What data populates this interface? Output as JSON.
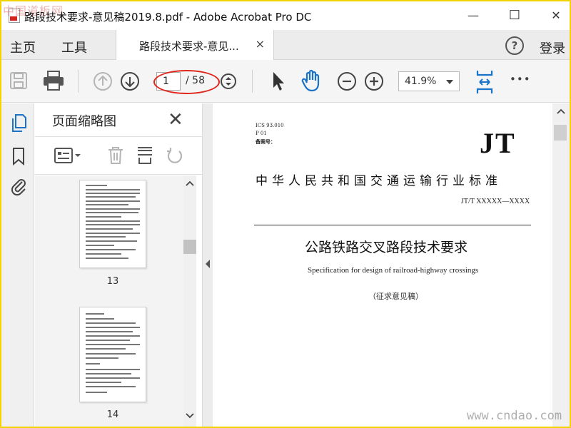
{
  "window": {
    "title": "路段技术要求-意见稿2019.8.pdf - Adobe Acrobat Pro DC",
    "watermark_top": "中国道板网",
    "minimize": "—",
    "maximize": "☐",
    "close": "✕"
  },
  "tabs": {
    "home": "主页",
    "tools": "工具",
    "document_tab": "路段技术要求-意见...",
    "document_tab_close": "×",
    "help": "?",
    "login": "登录"
  },
  "toolbar": {
    "current_page": "1",
    "page_total": "/ 58",
    "zoom": "41.9%",
    "more": "•••"
  },
  "thumbnail_panel": {
    "title": "页面缩略图",
    "close": "✕",
    "thumbnails": [
      {
        "page": "13"
      },
      {
        "page": "14"
      }
    ]
  },
  "document": {
    "ics": "ICS 93.010",
    "category": "P 01",
    "record_no": "备案号：",
    "logo": "JT",
    "standard_title": "中华人民共和国交通运输行业标准",
    "standard_code": "JT/T XXXXX—XXXX",
    "cn_title": "公路铁路交叉路段技术要求",
    "en_title": "Specification for design of railroad-highway crossings",
    "draft_note": "（征求意见稿）"
  },
  "watermark_bottom": "www.cndao.com",
  "colors": {
    "frame_border": "#f2d200",
    "accent_blue": "#1a73c8",
    "highlight_ellipse": "#e0261b"
  }
}
